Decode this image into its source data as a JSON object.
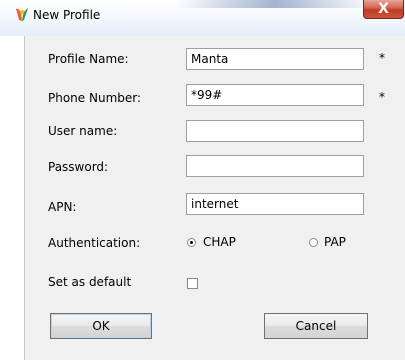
{
  "window": {
    "title": "New Profile",
    "close_label": "X"
  },
  "form": {
    "profile_name": {
      "label": "Profile Name:",
      "value": "Manta",
      "required_marker": "*"
    },
    "phone_number": {
      "label": "Phone Number:",
      "value": "*99#",
      "required_marker": "*"
    },
    "user_name": {
      "label": "User name:",
      "value": ""
    },
    "password": {
      "label": "Password:",
      "value": ""
    },
    "apn": {
      "label": "APN:",
      "value": "internet"
    },
    "authentication": {
      "label": "Authentication:",
      "options": [
        "CHAP",
        "PAP"
      ],
      "selected": "CHAP"
    },
    "set_as_default": {
      "label": "Set as default",
      "checked": false
    }
  },
  "buttons": {
    "ok": "OK",
    "cancel": "Cancel"
  },
  "icons": {
    "app": "app-logo-icon",
    "close": "close-icon"
  },
  "colors": {
    "panel_background": "#f0f0f0",
    "close_button": "#c9553f"
  }
}
